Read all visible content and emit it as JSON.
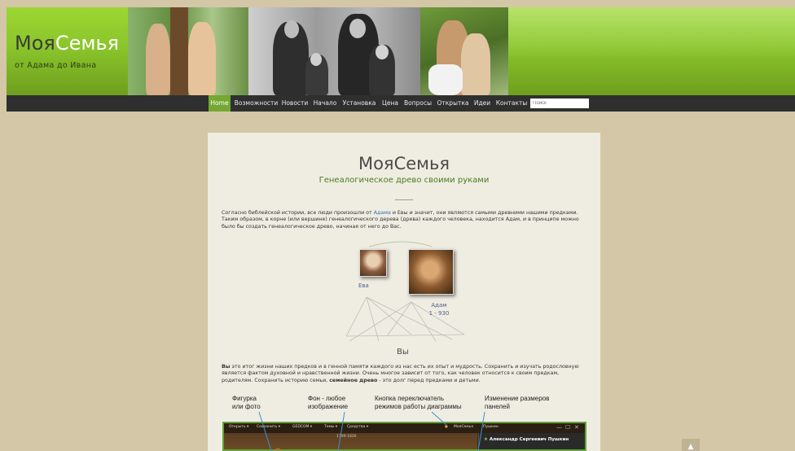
{
  "header": {
    "logo_dark": "Моя",
    "logo_accent": "Семья",
    "tagline": "от Адама до Ивана"
  },
  "nav": {
    "items": [
      "Home",
      "Возможности",
      "Новости",
      "Начало",
      "Установка",
      "Цена",
      "Вопросы",
      "Открытка",
      "Идеи",
      "Контакты"
    ],
    "active_index": 0,
    "search_placeholder": "Поиск"
  },
  "main": {
    "title": "МояСемья",
    "subtitle": "Генеалогическое древо своими руками",
    "intro_before_link": "Согласно библейской истории, все люди произошли от ",
    "intro_link": "Адама",
    "intro_after_link": " и Евы и значит, они являются самыми древними нашими предками. Таким образом, в корне (или вершине) генеалогического дерева (древа) каждого человека, находится Адам, и в принципе можно было бы создать генеалогическое древо, начиная от него до Вас.",
    "tree": {
      "eva_label": "Ева",
      "adam_label": "Адам",
      "adam_years": "1 - 930",
      "you_label": "Вы"
    },
    "outro_bold_start": "Вы",
    "outro_middle": " это итог жизни наших предков и в генной памяти каждого из нас есть их опыт и мудрость. Сохранить и изучать родословную является фактом духовной и нравственной жизни. Очень многое зависит от того, как человек относится к своим предкам, родителям. Сохранить историю семьи, ",
    "outro_bold_end": "семейное древо",
    "outro_tail": " - это долг перед предками и детьми."
  },
  "callouts": {
    "c1_line1": "Фигурка",
    "c1_line2": "или фото",
    "c2_line1": "Фон - любое",
    "c2_line2": "изображение",
    "c3_line1": "Кнопка переключатель",
    "c3_line2": "режимов работы диаграммы",
    "c4_line1": "Изменение размеров",
    "c4_line2": "панелей"
  },
  "app": {
    "menus": [
      "Открыть ▾",
      "Сохранить ▾",
      "GEDCOM ▾",
      "Темы ▾",
      "Средства ▾"
    ],
    "brand": "МояСемья",
    "person_tab": "Пушкин",
    "year_range": "1799-1836",
    "panel_title": "Александр Сергеевич Пушкин",
    "window_buttons": [
      "—",
      "☐",
      "✕"
    ]
  },
  "scroll_top_icon": "▲",
  "colors": {
    "page_bg": "#d4c7a7",
    "header_green": "#8ac62b",
    "nav_bg": "#2f2f2f",
    "nav_active": "#74a832",
    "content_bg": "#efede2",
    "subtitle_green": "#4c7a1e"
  }
}
